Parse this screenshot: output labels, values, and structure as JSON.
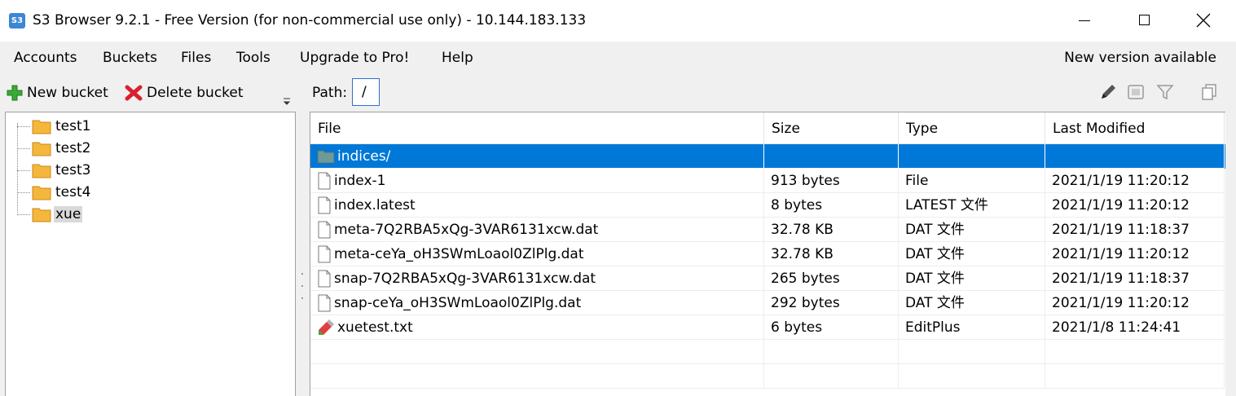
{
  "window": {
    "icon_text": "S3",
    "title": "S3 Browser 9.2.1 - Free Version (for non-commercial use only) - 10.144.183.133"
  },
  "menu": {
    "items": [
      "Accounts",
      "Buckets",
      "Files",
      "Tools",
      "Upgrade to Pro!",
      "Help"
    ],
    "notice": "New version available"
  },
  "left_toolbar": {
    "new_bucket": "New bucket",
    "delete_bucket": "Delete bucket"
  },
  "tree": {
    "buckets": [
      "test1",
      "test2",
      "test3",
      "test4",
      "xue"
    ],
    "selected": "xue"
  },
  "path_bar": {
    "label": "Path:",
    "value": "/"
  },
  "right_toolbar_icons": [
    "pencil-icon",
    "view-icon",
    "filter-icon",
    "copy-icon"
  ],
  "file_table": {
    "columns": [
      "File",
      "Size",
      "Type",
      "Last Modified"
    ],
    "rows": [
      {
        "name": "indices/",
        "size": "",
        "type": "",
        "modified": "",
        "kind": "folder",
        "selected": true
      },
      {
        "name": "index-1",
        "size": "913 bytes",
        "type": "File",
        "modified": "2021/1/19 11:20:12",
        "kind": "file"
      },
      {
        "name": "index.latest",
        "size": "8 bytes",
        "type": "LATEST 文件",
        "modified": "2021/1/19 11:20:12",
        "kind": "file"
      },
      {
        "name": "meta-7Q2RBA5xQg-3VAR6131xcw.dat",
        "size": "32.78 KB",
        "type": "DAT 文件",
        "modified": "2021/1/19 11:18:37",
        "kind": "file"
      },
      {
        "name": "meta-ceYa_oH3SWmLoaol0ZlPlg.dat",
        "size": "32.78 KB",
        "type": "DAT 文件",
        "modified": "2021/1/19 11:20:12",
        "kind": "file"
      },
      {
        "name": "snap-7Q2RBA5xQg-3VAR6131xcw.dat",
        "size": "265 bytes",
        "type": "DAT 文件",
        "modified": "2021/1/19 11:18:37",
        "kind": "file"
      },
      {
        "name": "snap-ceYa_oH3SWmLoaol0ZlPlg.dat",
        "size": "292 bytes",
        "type": "DAT 文件",
        "modified": "2021/1/19 11:20:12",
        "kind": "file"
      },
      {
        "name": "xuetest.txt",
        "size": "6 bytes",
        "type": "EditPlus",
        "modified": "2021/1/8 11:24:41",
        "kind": "editplus"
      }
    ]
  },
  "colors": {
    "selection": "#0078d7",
    "folder": "#f5b63c",
    "delete_red": "#d9202f",
    "add_green": "#3aaa35"
  }
}
